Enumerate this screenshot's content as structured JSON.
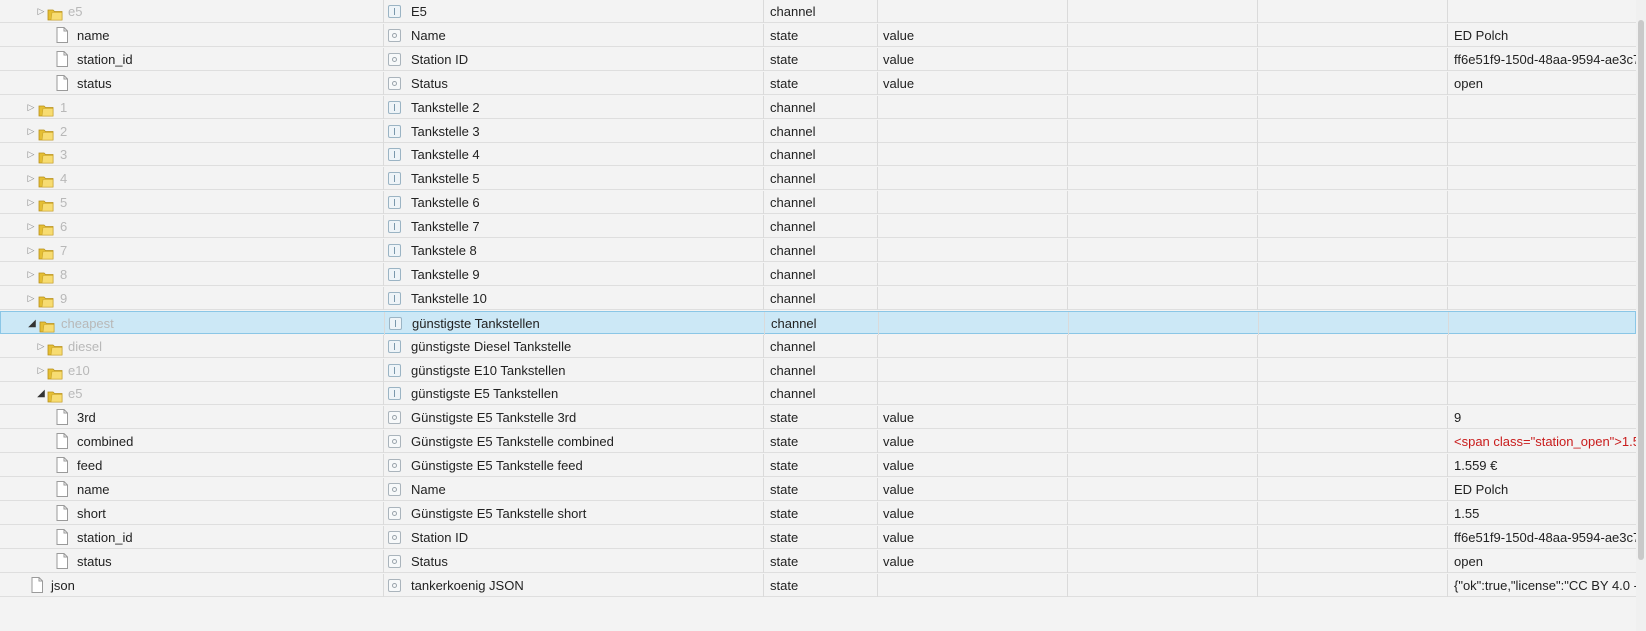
{
  "colors": {
    "folder": "#e5bf34",
    "selected_row": "#cce8f6",
    "html_value": "#c91c1c"
  },
  "rows": [
    {
      "level": 2,
      "kind": "folder",
      "expanded": false,
      "dim": true,
      "id": "e5",
      "name": "E5",
      "name_icon": "channel",
      "type": "channel",
      "role": "",
      "value": ""
    },
    {
      "level": 3,
      "kind": "file",
      "dim": false,
      "id": "name",
      "name": "Name",
      "name_icon": "state",
      "type": "state",
      "role": "value",
      "value": "ED Polch"
    },
    {
      "level": 3,
      "kind": "file",
      "dim": false,
      "id": "station_id",
      "name": "Station ID",
      "name_icon": "state",
      "type": "state",
      "role": "value",
      "value": "ff6e51f9-150d-48aa-9594-ae3c7"
    },
    {
      "level": 3,
      "kind": "file",
      "dim": false,
      "id": "status",
      "name": "Status",
      "name_icon": "state",
      "type": "state",
      "role": "value",
      "value": "open"
    },
    {
      "level": 1,
      "kind": "folder",
      "expanded": false,
      "dim": true,
      "id": "1",
      "name": "Tankstelle 2",
      "name_icon": "channel",
      "type": "channel",
      "role": "",
      "value": ""
    },
    {
      "level": 1,
      "kind": "folder",
      "expanded": false,
      "dim": true,
      "id": "2",
      "name": "Tankstelle 3",
      "name_icon": "channel",
      "type": "channel",
      "role": "",
      "value": ""
    },
    {
      "level": 1,
      "kind": "folder",
      "expanded": false,
      "dim": true,
      "id": "3",
      "name": "Tankstelle 4",
      "name_icon": "channel",
      "type": "channel",
      "role": "",
      "value": ""
    },
    {
      "level": 1,
      "kind": "folder",
      "expanded": false,
      "dim": true,
      "id": "4",
      "name": "Tankstelle 5",
      "name_icon": "channel",
      "type": "channel",
      "role": "",
      "value": ""
    },
    {
      "level": 1,
      "kind": "folder",
      "expanded": false,
      "dim": true,
      "id": "5",
      "name": "Tankstelle 6",
      "name_icon": "channel",
      "type": "channel",
      "role": "",
      "value": ""
    },
    {
      "level": 1,
      "kind": "folder",
      "expanded": false,
      "dim": true,
      "id": "6",
      "name": "Tankstelle 7",
      "name_icon": "channel",
      "type": "channel",
      "role": "",
      "value": ""
    },
    {
      "level": 1,
      "kind": "folder",
      "expanded": false,
      "dim": true,
      "id": "7",
      "name": "Tankstele 8",
      "name_icon": "channel",
      "type": "channel",
      "role": "",
      "value": ""
    },
    {
      "level": 1,
      "kind": "folder",
      "expanded": false,
      "dim": true,
      "id": "8",
      "name": "Tankstelle 9",
      "name_icon": "channel",
      "type": "channel",
      "role": "",
      "value": ""
    },
    {
      "level": 1,
      "kind": "folder",
      "expanded": false,
      "dim": true,
      "id": "9",
      "name": "Tankstelle 10",
      "name_icon": "channel",
      "type": "channel",
      "role": "",
      "value": ""
    },
    {
      "level": 1,
      "kind": "folder",
      "expanded": true,
      "dim": true,
      "selected": true,
      "id": "cheapest",
      "name": "günstigste Tankstellen",
      "name_icon": "channel",
      "type": "channel",
      "role": "",
      "value": ""
    },
    {
      "level": 2,
      "kind": "folder",
      "expanded": false,
      "dim": true,
      "id": "diesel",
      "name": "günstigste Diesel Tankstelle",
      "name_icon": "channel",
      "type": "channel",
      "role": "",
      "value": ""
    },
    {
      "level": 2,
      "kind": "folder",
      "expanded": false,
      "dim": true,
      "id": "e10",
      "name": "günstigste E10 Tankstellen",
      "name_icon": "channel",
      "type": "channel",
      "role": "",
      "value": ""
    },
    {
      "level": 2,
      "kind": "folder",
      "expanded": true,
      "dim": true,
      "id": "e5",
      "name": "günstigste E5 Tankstellen",
      "name_icon": "channel",
      "type": "channel",
      "role": "",
      "value": ""
    },
    {
      "level": 3,
      "kind": "file",
      "dim": false,
      "id": "3rd",
      "name": "Günstigste E5 Tankstelle 3rd",
      "name_icon": "state",
      "type": "state",
      "role": "value",
      "value": "9"
    },
    {
      "level": 3,
      "kind": "file",
      "dim": false,
      "id": "combined",
      "name": "Günstigste E5 Tankstelle combined",
      "name_icon": "state",
      "type": "state",
      "role": "value",
      "value": "<span class=\"station_open\">1.5",
      "value_html": true
    },
    {
      "level": 3,
      "kind": "file",
      "dim": false,
      "id": "feed",
      "name": "Günstigste E5 Tankstelle feed",
      "name_icon": "state",
      "type": "state",
      "role": "value",
      "value": "1.559 €"
    },
    {
      "level": 3,
      "kind": "file",
      "dim": false,
      "id": "name",
      "name": "Name",
      "name_icon": "state",
      "type": "state",
      "role": "value",
      "value": "ED Polch"
    },
    {
      "level": 3,
      "kind": "file",
      "dim": false,
      "id": "short",
      "name": "Günstigste E5 Tankstelle short",
      "name_icon": "state",
      "type": "state",
      "role": "value",
      "value": "1.55"
    },
    {
      "level": 3,
      "kind": "file",
      "dim": false,
      "id": "station_id",
      "name": "Station ID",
      "name_icon": "state",
      "type": "state",
      "role": "value",
      "value": "ff6e51f9-150d-48aa-9594-ae3c7"
    },
    {
      "level": 3,
      "kind": "file",
      "dim": false,
      "id": "status",
      "name": "Status",
      "name_icon": "state",
      "type": "state",
      "role": "value",
      "value": "open"
    },
    {
      "level": 1,
      "kind": "file",
      "dim": false,
      "id": "json",
      "name": "tankerkoenig JSON",
      "name_icon": "state",
      "type": "state",
      "role": "",
      "value": "{\"ok\":true,\"license\":\"CC BY 4.0 -"
    }
  ]
}
